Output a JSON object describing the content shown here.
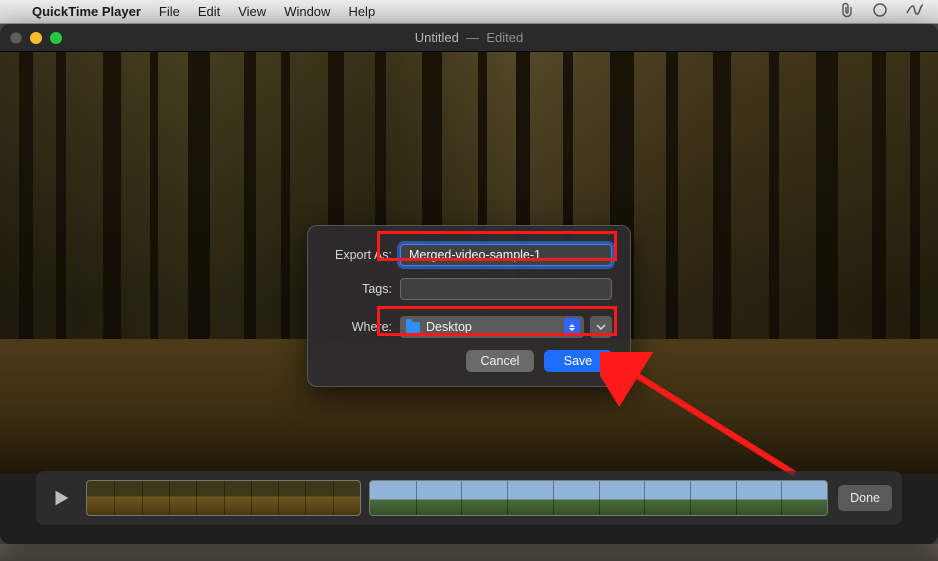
{
  "menubar": {
    "app_name": "QuickTime Player",
    "items": [
      "File",
      "Edit",
      "View",
      "Window",
      "Help"
    ]
  },
  "titlebar": {
    "document": "Untitled",
    "status": "Edited"
  },
  "dialog": {
    "export_as_label": "Export As:",
    "export_as_value": "Merged-video-sample-1",
    "tags_label": "Tags:",
    "tags_value": "",
    "where_label": "Where:",
    "where_value": "Desktop",
    "cancel": "Cancel",
    "save": "Save"
  },
  "timeline": {
    "done": "Done"
  }
}
